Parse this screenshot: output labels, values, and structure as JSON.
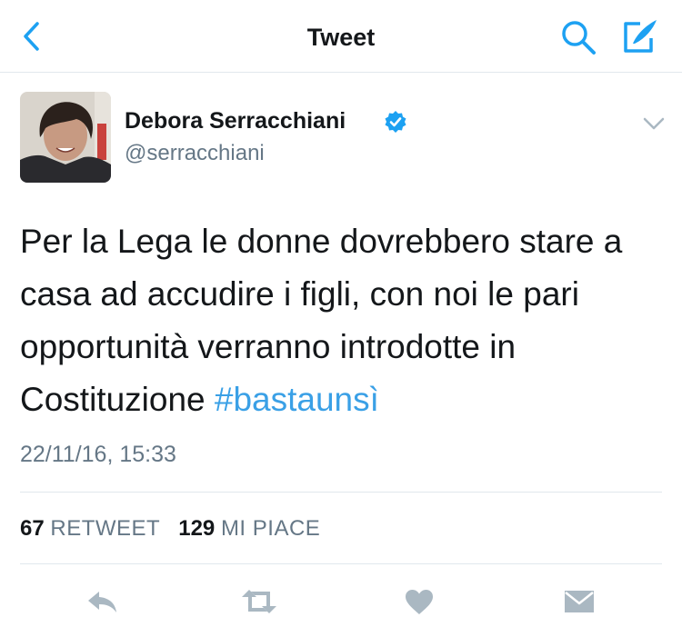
{
  "header": {
    "title": "Tweet",
    "back_icon": "chevron-left-icon",
    "search_icon": "search-icon",
    "compose_icon": "compose-icon",
    "accent_color": "#1da1f2"
  },
  "tweet": {
    "author_name": "Debora Serracchiani",
    "author_handle": "@serracchiani",
    "verified": true,
    "text": "Per la Lega le donne dovrebbero stare a casa ad accudire i figli, con noi le pari opportunità verranno introdotte in Costituzione",
    "hashtag": "#bastaunsì",
    "timestamp": "22/11/16, 15:33"
  },
  "stats": {
    "retweets": "67",
    "retweets_label": "RETWEET",
    "likes": "129",
    "likes_label": "MI PIACE"
  },
  "actions": [
    "reply",
    "retweet",
    "like",
    "direct-message"
  ]
}
